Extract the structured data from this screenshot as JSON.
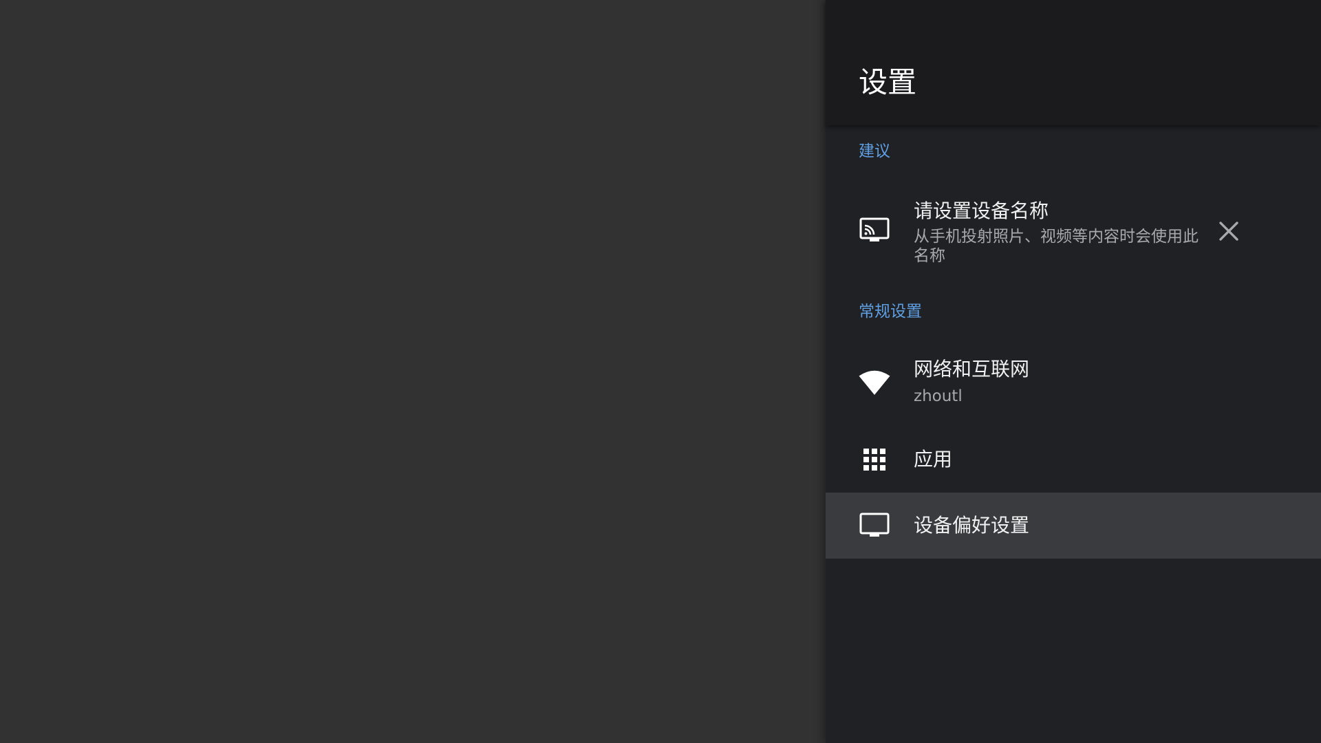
{
  "header": {
    "title": "设置"
  },
  "suggestions": {
    "section_label": "建议",
    "device_name": {
      "icon": "cast-icon",
      "title": "请设置设备名称",
      "subtitle": "从手机投射照片、视频等内容时会使用此名称",
      "dismiss_icon": "close-icon"
    }
  },
  "general": {
    "section_label": "常规设置",
    "items": [
      {
        "icon": "wifi-icon",
        "title": "网络和互联网",
        "subtitle": "zhoutl"
      },
      {
        "icon": "apps-grid-icon",
        "title": "应用"
      },
      {
        "icon": "tv-icon",
        "title": "设备偏好设置"
      }
    ]
  },
  "colors": {
    "background": "#323232",
    "panel": "#202124",
    "header": "#1b1b1d",
    "accent": "#5f9fe2",
    "focused_row": "#3a3b3e"
  }
}
